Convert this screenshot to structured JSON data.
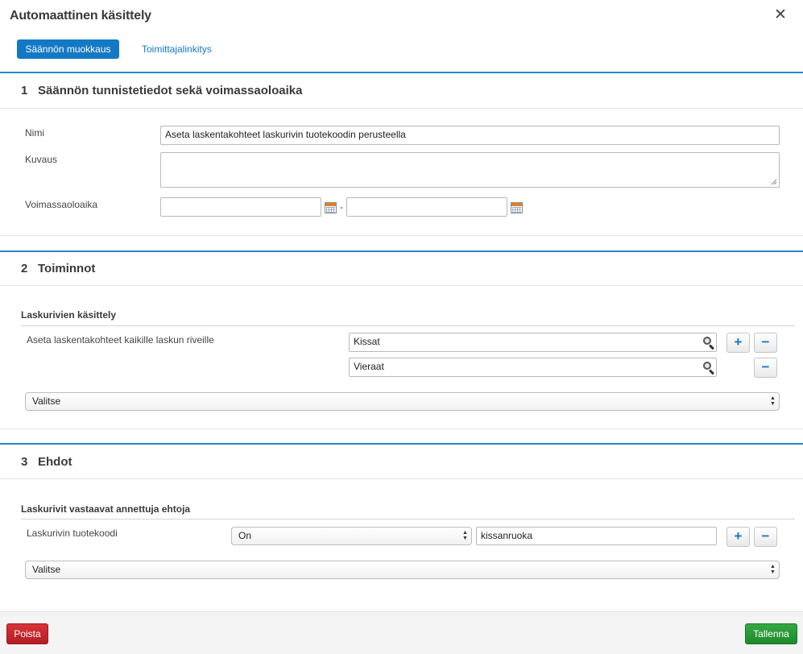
{
  "dialog": {
    "title": "Automaattinen käsittely",
    "close_symbol": "✕"
  },
  "tabs": [
    {
      "label": "Säännön muokkaus",
      "active": true
    },
    {
      "label": "Toimittajalinkitys",
      "active": false
    }
  ],
  "section1": {
    "number": "1",
    "title": "Säännön tunnistetiedot sekä voimassaoloaika",
    "name_label": "Nimi",
    "name_value": "Aseta laskentakohteet laskurivin tuotekoodin perusteella",
    "description_label": "Kuvaus",
    "description_value": "",
    "validity_label": "Voimassaoloaika",
    "validity_start": "",
    "validity_separator": "-",
    "validity_end": ""
  },
  "section2": {
    "number": "2",
    "title": "Toiminnot",
    "subheading": "Laskurivien käsittely",
    "action_label": "Aseta laskentakohteet kaikille laskun riveille",
    "targets": [
      "Kissat",
      "Vieraat"
    ],
    "add_label": "+",
    "remove_label": "−",
    "select_value": "Valitse"
  },
  "section3": {
    "number": "3",
    "title": "Ehdot",
    "subheading": "Laskurivit vastaavat annettuja ehtoja",
    "condition_label": "Laskurivin tuotekoodi",
    "operator_value": "On",
    "condition_value": "kissanruoka",
    "add_label": "+",
    "remove_label": "−",
    "select_value": "Valitse"
  },
  "footer": {
    "delete_label": "Poista",
    "save_label": "Tallenna"
  },
  "colors": {
    "primary": "#1479c4",
    "danger": "#c1272d",
    "success": "#2a9a38",
    "section_rule": "#2a86c8"
  },
  "icons": [
    "close-icon",
    "calendar-icon",
    "search-icon",
    "select-arrows-icon"
  ]
}
